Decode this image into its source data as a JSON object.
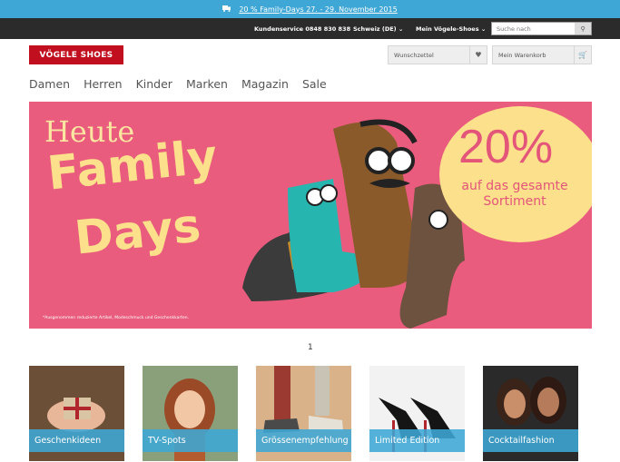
{
  "promo": {
    "icon": "truck-icon",
    "link_text": "20 % Family-Days 27. - 29. November 2015"
  },
  "topbar": {
    "service": "Kundenservice 0848 830 838",
    "country": "Schweiz (DE)",
    "account": "Mein Vögele-Shoes",
    "search_placeholder": "Suche nach",
    "search_icon": "search-icon"
  },
  "header": {
    "logo": "VÖGELE SHOES",
    "wishlist": "Wunschzettel",
    "wishlist_icon": "heart-icon",
    "cart": "Mein Warenkorb",
    "cart_icon": "cart-icon"
  },
  "nav": [
    "Damen",
    "Herren",
    "Kinder",
    "Marken",
    "Magazin",
    "Sale"
  ],
  "hero": {
    "line1": "Heute",
    "line2": "Family",
    "line3": "Days",
    "percent": "20%",
    "sub": "auf das gesamte Sortiment",
    "footnote": "*Ausgenommen reduzierte Artikel, Modeschmuck und Geschenkkarten."
  },
  "pager": "1",
  "tiles": [
    "Geschenkideen",
    "TV-Spots",
    "Grössenempfehlung",
    "Limited Edition",
    "Cocktailfashion"
  ],
  "colors": {
    "accent": "#3ea7d6",
    "brand": "#c10f1f",
    "hero_bg": "#e95c7e",
    "hero_text": "#fde08b"
  }
}
